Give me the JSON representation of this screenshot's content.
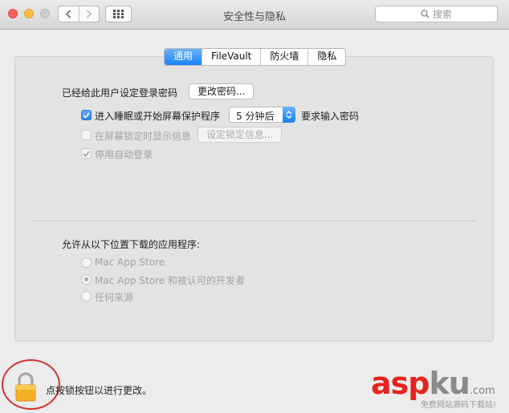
{
  "window": {
    "title": "安全性与隐私",
    "search_placeholder": "搜索"
  },
  "tabs": [
    {
      "label": "通用",
      "active": true
    },
    {
      "label": "FileVault",
      "active": false
    },
    {
      "label": "防火墙",
      "active": false
    },
    {
      "label": "隐私",
      "active": false
    }
  ],
  "general": {
    "password_label": "已经给此用户设定登录密码",
    "change_password_button": "更改密码...",
    "sleep_checkbox_label": "进入睡眠或开始屏幕保护程序",
    "sleep_checked": true,
    "sleep_delay_value": "5 分钟后",
    "require_password_label": "要求输入密码",
    "show_message_label": "在屏幕锁定时显示信息",
    "show_message_checked": false,
    "set_lock_message_button": "设定锁定信息...",
    "disable_autologin_label": "停用自动登录",
    "disable_autologin_checked": true
  },
  "downloads": {
    "label": "允许从以下位置下载的应用程序:",
    "options": [
      {
        "label": "Mac App Store",
        "selected": false
      },
      {
        "label": "Mac App Store 和被认可的开发者",
        "selected": true
      },
      {
        "label": "任何来源",
        "selected": false
      }
    ]
  },
  "lock": {
    "text": "点按锁按钮以进行更改。"
  },
  "watermark": {
    "brand_part1": "asp",
    "brand_part2": "ku",
    "brand_suffix": ".com",
    "tagline": "免费网站源码下载站!"
  },
  "colors": {
    "accent": "#1a82fb",
    "circle": "#d2342e",
    "watermark_red": "#e8221d"
  }
}
